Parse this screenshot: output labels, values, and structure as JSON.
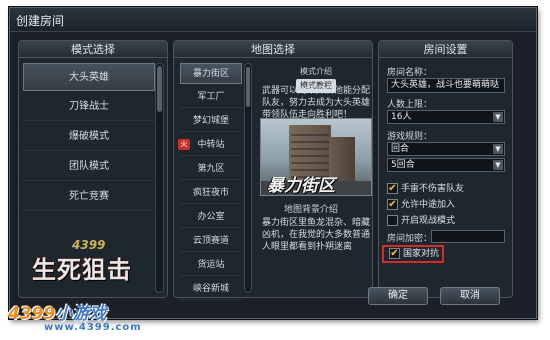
{
  "window": {
    "title": "创建房间"
  },
  "mode_panel": {
    "header": "模式选择",
    "items": [
      {
        "label": "大头英雄",
        "selected": true
      },
      {
        "label": "刀锋战士",
        "selected": false
      },
      {
        "label": "爆破模式",
        "selected": false
      },
      {
        "label": "团队模式",
        "selected": false
      },
      {
        "label": "死亡竞赛",
        "selected": false
      }
    ]
  },
  "logo": {
    "brand": "4399",
    "game": "生死狙击"
  },
  "map_panel": {
    "header": "地图选择",
    "maps": [
      {
        "label": "暴力街区",
        "selected": true,
        "badge": ""
      },
      {
        "label": "军工厂",
        "selected": false,
        "badge": ""
      },
      {
        "label": "梦幻城堡",
        "selected": false,
        "badge": ""
      },
      {
        "label": "中转站",
        "selected": false,
        "badge": "火"
      },
      {
        "label": "第九区",
        "selected": false,
        "badge": ""
      },
      {
        "label": "疯狂夜市",
        "selected": false,
        "badge": ""
      },
      {
        "label": "办公室",
        "selected": false,
        "badge": ""
      },
      {
        "label": "云顶赛道",
        "selected": false,
        "badge": ""
      },
      {
        "label": "货运站",
        "selected": false,
        "badge": ""
      },
      {
        "label": "峡谷新城",
        "selected": false,
        "badge": ""
      }
    ],
    "tabs": [
      "模式介绍",
      "模式教程"
    ],
    "mode_desc": "武器可以用来开启他能分配队友，努力去成为大头英雄带领队伍走向胜利吧！",
    "preview_title": "暴力街区",
    "background_title": "地图背景介绍",
    "background_desc": "暴力街区里鱼龙混杂、暗藏凶机，在我觉的大多数普通人眼里都看到扑朔迷离"
  },
  "room_panel": {
    "header": "房间设置",
    "room_name_label": "房间名称：",
    "room_name_value": "大头英雄，战斗也要萌萌哒",
    "players_label": "人数上限：",
    "players_value": "16人",
    "rules_label": "游戏规则：",
    "rule_type": "回合",
    "rule_count": "5回合",
    "checks": [
      {
        "label": "手雷不伤害队友",
        "checked": true
      },
      {
        "label": "允许中途加入",
        "checked": true
      },
      {
        "label": "开启观战模式",
        "checked": false
      }
    ],
    "password_label": "房间加密：",
    "country_battle": {
      "label": "国家对抗",
      "checked": true
    }
  },
  "buttons": {
    "confirm": "确定",
    "cancel": "取消"
  },
  "watermark": {
    "brand": "4399",
    "accent": "小游戏",
    "url": "www.4399.com"
  }
}
